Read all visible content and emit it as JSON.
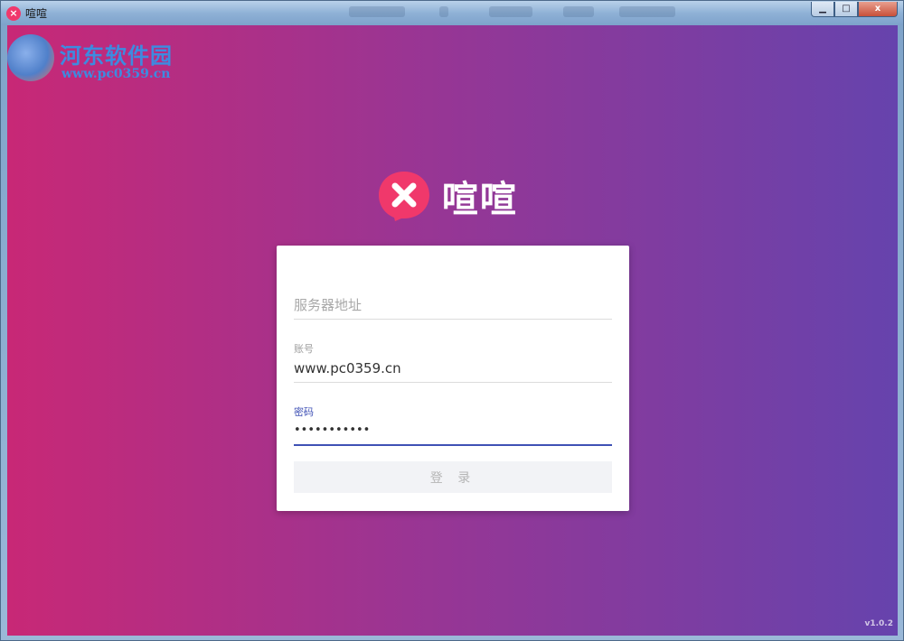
{
  "window": {
    "title": "喧喧",
    "minimize_label": "▁",
    "maximize_label": "□",
    "close_label": "x"
  },
  "watermark": {
    "title": "河东软件园",
    "url": "www.pc0359.cn"
  },
  "brand": {
    "name": "喧喧",
    "logo_icon": "x-chat-bubble-icon",
    "accent": "#f0386b"
  },
  "login": {
    "server": {
      "placeholder": "服务器地址",
      "value": ""
    },
    "account": {
      "label": "账号",
      "value": "www.pc0359.cn"
    },
    "password": {
      "label": "密码",
      "value": "•••••••••••"
    },
    "submit_label": "登 录"
  },
  "version": "v1.0.2",
  "colors": {
    "gradient_start": "#c82876",
    "gradient_end": "#6643ad",
    "focus_underline": "#3f51b5"
  }
}
